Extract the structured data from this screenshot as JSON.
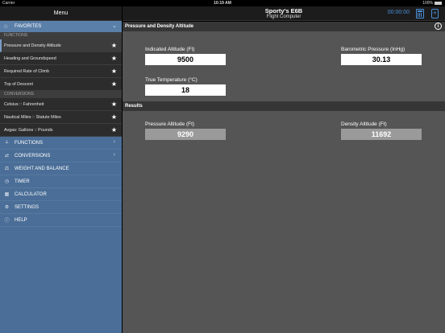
{
  "status": {
    "carrier": "Carrier",
    "time": "10:19 AM",
    "battery": "100%"
  },
  "sidebar": {
    "title": "Menu",
    "favorites_label": "FAVORITES",
    "functions_section": "FUNCTIONS",
    "functions": [
      "Pressure and Density Altitude",
      "Heading and Groundspeed",
      "Required Rate of Climb",
      "Top of Descent"
    ],
    "conversions_section": "CONVERSIONS",
    "conversions": [
      "Celsius :: Fahrenheit",
      "Nautical Miles :: Statute Miles",
      "Avgas: Gallons :: Pounds"
    ],
    "menu": [
      {
        "label": "FUNCTIONS",
        "icon": "functions-icon"
      },
      {
        "label": "CONVERSIONS",
        "icon": "conversions-icon"
      },
      {
        "label": "WEIGHT AND BALANCE",
        "icon": "weight-balance-icon"
      },
      {
        "label": "TIMER",
        "icon": "timer-icon"
      },
      {
        "label": "CALCULATOR",
        "icon": "calculator-icon"
      },
      {
        "label": "SETTINGS",
        "icon": "settings-icon"
      },
      {
        "label": "HELP",
        "icon": "help-icon"
      }
    ]
  },
  "header": {
    "title": "Sporty's E6B",
    "subtitle": "Flight Computer",
    "timer": "00:00:00",
    "accent_color": "#4a8fd8"
  },
  "calculator": {
    "title": "Pressure and Density Altitude",
    "inputs": {
      "indicated_altitude_label": "Indicated Altitude (Ft)",
      "indicated_altitude_value": "9500",
      "barometric_pressure_label": "Barometric Pressure (InHg)",
      "barometric_pressure_value": "30.13",
      "true_temperature_label": "True Temperature (°C)",
      "true_temperature_value": "18"
    },
    "results_title": "Results",
    "results": {
      "pressure_altitude_label": "Pressure Altitude (Ft)",
      "pressure_altitude_value": "9290",
      "density_altitude_label": "Density Altitude (Ft)",
      "density_altitude_value": "11692"
    }
  }
}
